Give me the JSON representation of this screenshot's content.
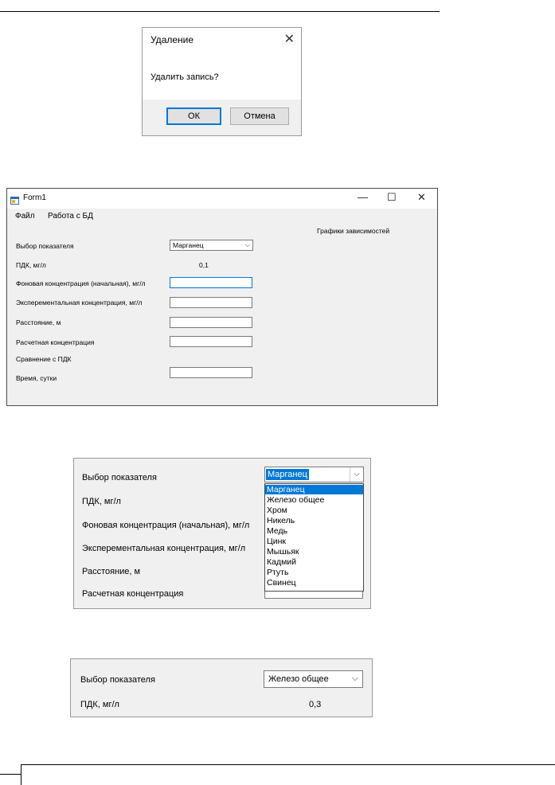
{
  "dialog": {
    "title": "Удаление",
    "close_glyph": "✕",
    "message": "Удалить запись?",
    "ok_label": "ОК",
    "cancel_label": "Отмена"
  },
  "form": {
    "title": "Form1",
    "min_glyph": "—",
    "max_glyph": "☐",
    "close_glyph": "✕",
    "menu": [
      "Файл",
      "Работа с БД"
    ],
    "graphs_label": "Графики зависимостей",
    "indicator_label": "Выбор показателя",
    "indicator_value": "Марганец",
    "pdk_label": "ПДК, мг/л",
    "pdk_value": "0,1",
    "background_label": "Фоновая концентрация (начальная), мг/л",
    "experimental_label": "Эксперементальная концентрация, мг/л",
    "distance_label": "Расстояние, м",
    "calculated_label": "Расчетная концентрация",
    "comparison_label": "Сравнение с ПДК",
    "time_label": "Время, сутки"
  },
  "dropdown_view": {
    "indicator_label": "Выбор показателя",
    "pdk_label": "ПДК, мг/л",
    "background_label": "Фоновая концентрация (начальная), мг/л",
    "experimental_label": "Эксперементальная концентрация, мг/л",
    "distance_label": "Расстояние, м",
    "calculated_label": "Расчетная концентрация",
    "selected_value": "Марганец",
    "arrow_glyph": "⌵",
    "options": [
      "Марганец",
      "Железо общее",
      "Хром",
      "Никель",
      "Медь",
      "Цинк",
      "Мышьяк",
      "Кадмий",
      "Ртуть",
      "Свинец"
    ]
  },
  "selection_view": {
    "indicator_label": "Выбор показателя",
    "indicator_value": "Железо общее",
    "pdk_label": "ПДК, мг/л",
    "pdk_value": "0,3",
    "arrow_glyph": "⌵"
  },
  "icons": {
    "form_icon": "window-app-icon",
    "chevron": "chevron-down-icon"
  }
}
